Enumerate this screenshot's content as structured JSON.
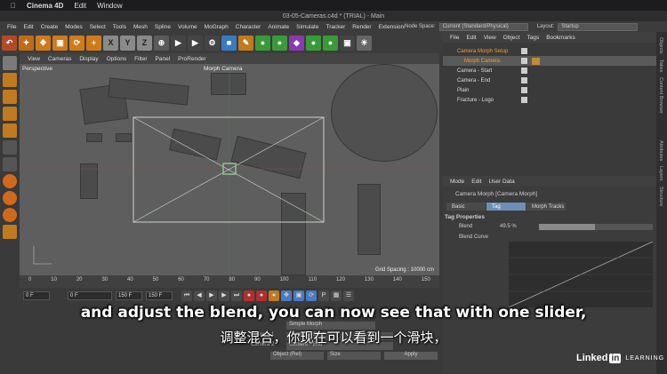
{
  "mac_menu": {
    "app": "Cinema 4D",
    "items": [
      "Edit",
      "Window"
    ]
  },
  "window_title": "03-05-Cameras.c4d * (TRIAL) - Main",
  "main_menu": [
    "File",
    "Edit",
    "Create",
    "Modes",
    "Select",
    "Tools",
    "Mesh",
    "Spline",
    "Volume",
    "MoGraph",
    "Character",
    "Animate",
    "Simulate",
    "Tracker",
    "Render",
    "Extensions"
  ],
  "node_space": {
    "label": "Node Space:",
    "value": "Current (Standard/Physical)"
  },
  "layout": {
    "label": "Layout:",
    "value": "Startup"
  },
  "toolbar": {
    "x": "X",
    "y": "Y",
    "z": "Z"
  },
  "viewport_menu": [
    "View",
    "Cameras",
    "Display",
    "Options",
    "Filter",
    "Panel",
    "ProRender"
  ],
  "viewport": {
    "name": "Perspective",
    "camera": "Morph Camera",
    "grid_spacing": "Grid Spacing : 10000 cm"
  },
  "timeline": {
    "ticks": [
      "0",
      "10",
      "20",
      "30",
      "40",
      "50",
      "60",
      "70",
      "80",
      "90",
      "100",
      "110",
      "120",
      "130",
      "140",
      "150"
    ],
    "unit": "0 F"
  },
  "transport": {
    "start": "0 F",
    "current": "0 F",
    "end": "150 F",
    "end2": "150 F"
  },
  "object_manager": {
    "menu": [
      "File",
      "Edit",
      "View",
      "Object",
      "Tags",
      "Bookmarks"
    ],
    "objects": [
      {
        "name": "Camera Morph Setup"
      },
      {
        "name": "Morph Camera"
      },
      {
        "name": "Camera - Start"
      },
      {
        "name": "Camera - End"
      },
      {
        "name": "Plain"
      },
      {
        "name": "Fracture - Logo"
      }
    ]
  },
  "attributes": {
    "menu": [
      "Mode",
      "Edit",
      "User Data"
    ],
    "heading": "Camera Morph [Camera Morph]",
    "tabs": [
      "Basic",
      "Tag",
      "Morph Tracks"
    ],
    "section": "Tag Properties",
    "blend_label": "Blend",
    "blend_value": "49.5 %",
    "blend_fraction": 0.495,
    "curve_label": "Blend Curve",
    "curve_ticks": [
      "0.8",
      "0.6",
      "0.4",
      "0.2",
      "0.0"
    ],
    "curve_x_ticks": [
      "0.0",
      "0.2",
      "0.4",
      "0.6",
      "0.8",
      "1.0"
    ]
  },
  "bottom": {
    "morph_mode": "Simple Morph",
    "camera1_label": "Camera 1",
    "camera1": "Camera - Start",
    "camera2_label": "Camera 2",
    "camera2": "Camera - End",
    "coord_mode": "Object (Rel)",
    "size_mode": "Size",
    "apply": "Apply"
  },
  "right_strip": [
    "Objects",
    "Takes",
    "Content Browser",
    "Attributes",
    "Layers",
    "Structure"
  ],
  "subtitles": {
    "english": "and adjust the blend, you can now see that with one slider,",
    "chinese": "调整混合，你现在可以看到一个滑块，"
  },
  "brand": {
    "name": "Linked",
    "in": "in",
    "learning": "LEARNING"
  },
  "colors": {
    "accent": "#6d8fb5",
    "selected": "#f0a030",
    "camera_frame": "#c9d4c9"
  }
}
